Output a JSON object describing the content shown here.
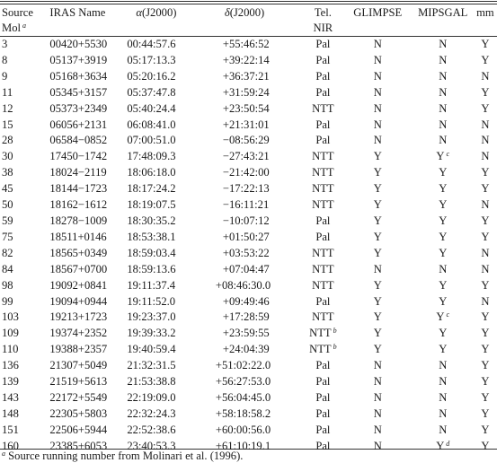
{
  "table": {
    "headers": [
      {
        "line1": "Source",
        "line2": "Mol",
        "sup": "a"
      },
      {
        "line1": "IRAS Name",
        "line2": ""
      },
      {
        "greek": "α",
        "line1": "(J2000)",
        "line2": ""
      },
      {
        "greek": "δ",
        "line1": "(J2000)",
        "line2": ""
      },
      {
        "line1": "Tel.",
        "line2": "NIR"
      },
      {
        "line1": "GLIMPSE",
        "line2": ""
      },
      {
        "line1": "MIPSGAL",
        "line2": ""
      },
      {
        "line1": "mm",
        "line2": ""
      }
    ],
    "rows": [
      {
        "mol": "3",
        "iras": "00420+5530",
        "ra": "00:44:57.6",
        "dec": "+55:46:52",
        "tel": "Pal",
        "tel_sup": "",
        "glimpse": "N",
        "mipsgal": "N",
        "mipsgal_sup": "",
        "mm": "Y"
      },
      {
        "mol": "8",
        "iras": "05137+3919",
        "ra": "05:17:13.3",
        "dec": "+39:22:14",
        "tel": "Pal",
        "tel_sup": "",
        "glimpse": "N",
        "mipsgal": "N",
        "mipsgal_sup": "",
        "mm": "Y"
      },
      {
        "mol": "9",
        "iras": "05168+3634",
        "ra": "05:20:16.2",
        "dec": "+36:37:21",
        "tel": "Pal",
        "tel_sup": "",
        "glimpse": "N",
        "mipsgal": "N",
        "mipsgal_sup": "",
        "mm": "N"
      },
      {
        "mol": "11",
        "iras": "05345+3157",
        "ra": "05:37:47.8",
        "dec": "+31:59:24",
        "tel": "Pal",
        "tel_sup": "",
        "glimpse": "N",
        "mipsgal": "N",
        "mipsgal_sup": "",
        "mm": "Y"
      },
      {
        "mol": "12",
        "iras": "05373+2349",
        "ra": "05:40:24.4",
        "dec": "+23:50:54",
        "tel": "NTT",
        "tel_sup": "",
        "glimpse": "N",
        "mipsgal": "N",
        "mipsgal_sup": "",
        "mm": "Y"
      },
      {
        "mol": "15",
        "iras": "06056+2131",
        "ra": "06:08:41.0",
        "dec": "+21:31:01",
        "tel": "Pal",
        "tel_sup": "",
        "glimpse": "N",
        "mipsgal": "N",
        "mipsgal_sup": "",
        "mm": "N"
      },
      {
        "mol": "28",
        "iras": "06584−0852",
        "ra": "07:00:51.0",
        "dec": "−08:56:29",
        "tel": "Pal",
        "tel_sup": "",
        "glimpse": "N",
        "mipsgal": "N",
        "mipsgal_sup": "",
        "mm": "N"
      },
      {
        "mol": "30",
        "iras": "17450−1742",
        "ra": "17:48:09.3",
        "dec": "−27:43:21",
        "tel": "NTT",
        "tel_sup": "",
        "glimpse": "Y",
        "mipsgal": "Y",
        "mipsgal_sup": "c",
        "mm": "N"
      },
      {
        "mol": "38",
        "iras": "18024−2119",
        "ra": "18:06:18.0",
        "dec": "−21:42:00",
        "tel": "NTT",
        "tel_sup": "",
        "glimpse": "Y",
        "mipsgal": "Y",
        "mipsgal_sup": "",
        "mm": "Y"
      },
      {
        "mol": "45",
        "iras": "18144−1723",
        "ra": "18:17:24.2",
        "dec": "−17:22:13",
        "tel": "NTT",
        "tel_sup": "",
        "glimpse": "Y",
        "mipsgal": "Y",
        "mipsgal_sup": "",
        "mm": "Y"
      },
      {
        "mol": "50",
        "iras": "18162−1612",
        "ra": "18:19:07.5",
        "dec": "−16:11:21",
        "tel": "NTT",
        "tel_sup": "",
        "glimpse": "Y",
        "mipsgal": "Y",
        "mipsgal_sup": "",
        "mm": "N"
      },
      {
        "mol": "59",
        "iras": "18278−1009",
        "ra": "18:30:35.2",
        "dec": "−10:07:12",
        "tel": "Pal",
        "tel_sup": "",
        "glimpse": "Y",
        "mipsgal": "Y",
        "mipsgal_sup": "",
        "mm": "Y"
      },
      {
        "mol": "75",
        "iras": "18511+0146",
        "ra": "18:53:38.1",
        "dec": "+01:50:27",
        "tel": "Pal",
        "tel_sup": "",
        "glimpse": "Y",
        "mipsgal": "Y",
        "mipsgal_sup": "",
        "mm": "Y"
      },
      {
        "mol": "82",
        "iras": "18565+0349",
        "ra": "18:59:03.4",
        "dec": "+03:53:22",
        "tel": "NTT",
        "tel_sup": "",
        "glimpse": "Y",
        "mipsgal": "Y",
        "mipsgal_sup": "",
        "mm": "N"
      },
      {
        "mol": "84",
        "iras": "18567+0700",
        "ra": "18:59:13.6",
        "dec": "+07:04:47",
        "tel": "NTT",
        "tel_sup": "",
        "glimpse": "N",
        "mipsgal": "N",
        "mipsgal_sup": "",
        "mm": "N"
      },
      {
        "mol": "98",
        "iras": "19092+0841",
        "ra": "19:11:37.4",
        "dec": "+08:46:30.0",
        "tel": "NTT",
        "tel_sup": "",
        "glimpse": "Y",
        "mipsgal": "Y",
        "mipsgal_sup": "",
        "mm": "Y"
      },
      {
        "mol": "99",
        "iras": "19094+0944",
        "ra": "19:11:52.0",
        "dec": "+09:49:46",
        "tel": "Pal",
        "tel_sup": "",
        "glimpse": "Y",
        "mipsgal": "Y",
        "mipsgal_sup": "",
        "mm": "N"
      },
      {
        "mol": "103",
        "iras": "19213+1723",
        "ra": "19:23:37.0",
        "dec": "+17:28:59",
        "tel": "NTT",
        "tel_sup": "",
        "glimpse": "Y",
        "mipsgal": "Y",
        "mipsgal_sup": "c",
        "mm": "Y"
      },
      {
        "mol": "109",
        "iras": "19374+2352",
        "ra": "19:39:33.2",
        "dec": "+23:59:55",
        "tel": "NTT",
        "tel_sup": "b",
        "glimpse": "Y",
        "mipsgal": "Y",
        "mipsgal_sup": "",
        "mm": "Y"
      },
      {
        "mol": "110",
        "iras": "19388+2357",
        "ra": "19:40:59.4",
        "dec": "+24:04:39",
        "tel": "NTT",
        "tel_sup": "b",
        "glimpse": "Y",
        "mipsgal": "Y",
        "mipsgal_sup": "",
        "mm": "Y"
      },
      {
        "mol": "136",
        "iras": "21307+5049",
        "ra": "21:32:31.5",
        "dec": "+51:02:22.0",
        "tel": "Pal",
        "tel_sup": "",
        "glimpse": "N",
        "mipsgal": "N",
        "mipsgal_sup": "",
        "mm": "Y"
      },
      {
        "mol": "139",
        "iras": "21519+5613",
        "ra": "21:53:38.8",
        "dec": "+56:27:53.0",
        "tel": "Pal",
        "tel_sup": "",
        "glimpse": "N",
        "mipsgal": "N",
        "mipsgal_sup": "",
        "mm": "Y"
      },
      {
        "mol": "143",
        "iras": "22172+5549",
        "ra": "22:19:09.0",
        "dec": "+56:04:45.0",
        "tel": "Pal",
        "tel_sup": "",
        "glimpse": "N",
        "mipsgal": "N",
        "mipsgal_sup": "",
        "mm": "Y"
      },
      {
        "mol": "148",
        "iras": "22305+5803",
        "ra": "22:32:24.3",
        "dec": "+58:18:58.2",
        "tel": "Pal",
        "tel_sup": "",
        "glimpse": "N",
        "mipsgal": "N",
        "mipsgal_sup": "",
        "mm": "Y"
      },
      {
        "mol": "151",
        "iras": "22506+5944",
        "ra": "22:52:38.6",
        "dec": "+60:00:56.0",
        "tel": "Pal",
        "tel_sup": "",
        "glimpse": "N",
        "mipsgal": "N",
        "mipsgal_sup": "",
        "mm": "Y"
      },
      {
        "mol": "160",
        "iras": "23385+6053",
        "ra": "23:40:53.3",
        "dec": "+61:10:19.1",
        "tel": "Pal",
        "tel_sup": "",
        "glimpse": "N",
        "mipsgal": "Y",
        "mipsgal_sup": "d",
        "mm": "Y"
      }
    ]
  },
  "footnote": {
    "sup": "a",
    "text": "Source running number from Molinari et al. (1996)."
  }
}
